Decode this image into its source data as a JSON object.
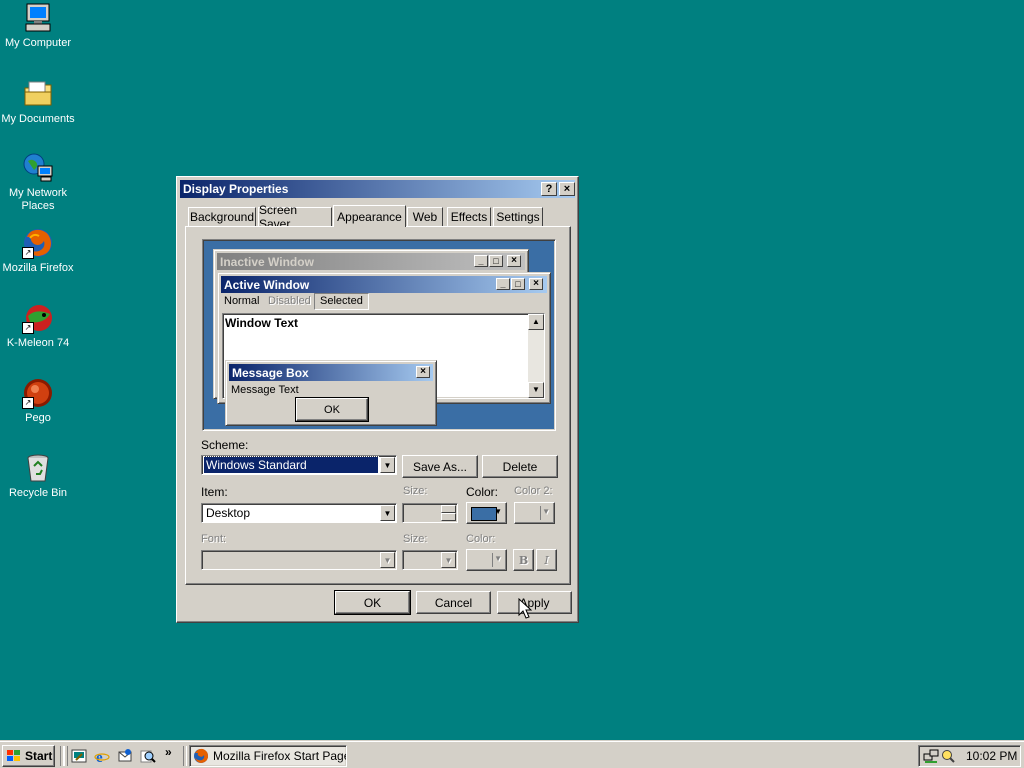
{
  "desktop": {
    "background_color": "#008080",
    "icons": [
      {
        "label": "My Computer",
        "icon": "computer-icon"
      },
      {
        "label": "My Documents",
        "icon": "folder-icon"
      },
      {
        "label": "My Network Places",
        "icon": "network-icon"
      },
      {
        "label": "Mozilla Firefox",
        "icon": "firefox-icon"
      },
      {
        "label": "K-Meleon 74",
        "icon": "kmeleon-icon"
      },
      {
        "label": "Pego",
        "icon": "pego-icon"
      },
      {
        "label": "Recycle Bin",
        "icon": "recycle-bin-icon"
      }
    ]
  },
  "dialog": {
    "title": "Display Properties",
    "help_glyph": "?",
    "close_glyph": "×",
    "tabs": [
      {
        "label": "Background",
        "active": false
      },
      {
        "label": "Screen Saver",
        "active": false
      },
      {
        "label": "Appearance",
        "active": true
      },
      {
        "label": "Web",
        "active": false
      },
      {
        "label": "Effects",
        "active": false
      },
      {
        "label": "Settings",
        "active": false
      }
    ],
    "preview": {
      "inactive_title": "Inactive Window",
      "active_title": "Active Window",
      "menu_normal": "Normal",
      "menu_disabled": "Disabled",
      "menu_selected": "Selected",
      "window_text": "Window Text",
      "message_title": "Message Box",
      "message_text": "Message Text",
      "ok": "OK"
    },
    "scheme": {
      "label": "Scheme:",
      "value": "Windows Standard",
      "save_as": "Save As...",
      "delete": "Delete"
    },
    "item": {
      "label": "Item:",
      "value": "Desktop",
      "size_label": "Size:",
      "color_label": "Color:",
      "color2_label": "Color 2:",
      "color_value": "#3a6ea5"
    },
    "font": {
      "label": "Font:",
      "size_label": "Size:",
      "color_label": "Color:",
      "bold": "B",
      "italic": "I"
    },
    "buttons": {
      "ok": "OK",
      "cancel": "Cancel",
      "apply": "Apply"
    }
  },
  "taskbar": {
    "start": "Start",
    "task": "Mozilla Firefox Start Page -...",
    "chevron": "»",
    "clock": "10:02 PM"
  },
  "colors": {
    "title_active_start": "#0a246a",
    "title_active_end": "#a6caf0",
    "title_inactive_start": "#808080",
    "title_inactive_end": "#c0c0c0",
    "face": "#d4d0c8",
    "selection": "#0a246a"
  }
}
